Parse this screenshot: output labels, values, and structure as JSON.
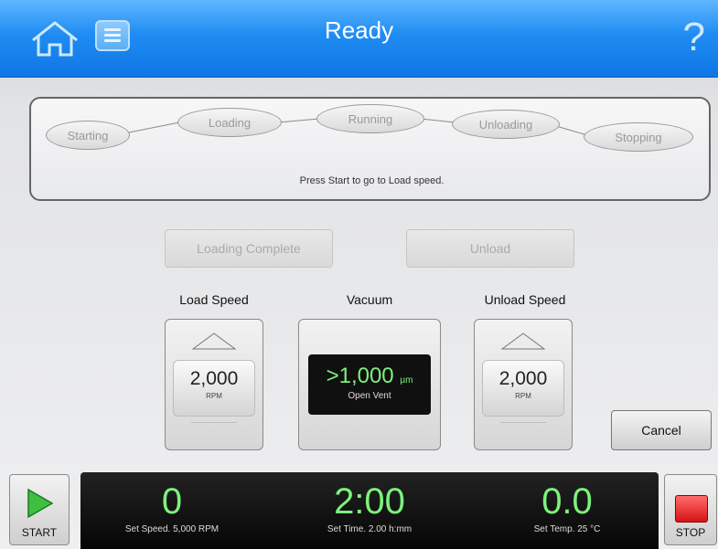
{
  "header": {
    "title": "Ready",
    "help_symbol": "?",
    "icons": [
      "home-icon",
      "list-icon",
      "help-icon"
    ]
  },
  "steps": {
    "items": [
      "Starting",
      "Loading",
      "Running",
      "Unloading",
      "Stopping"
    ],
    "message": "Press Start to go to Load speed."
  },
  "actions": {
    "loading_complete": "Loading Complete",
    "unload": "Unload"
  },
  "controls": {
    "load_speed": {
      "label": "Load Speed",
      "value": "2,000",
      "unit": "RPM"
    },
    "vacuum": {
      "label": "Vacuum",
      "value": ">1,000",
      "unit": "µm",
      "status": "Open Vent"
    },
    "unload_speed": {
      "label": "Unload Speed",
      "value": "2,000",
      "unit": "RPM"
    }
  },
  "cancel_label": "Cancel",
  "bottom": {
    "start_label": "START",
    "stop_label": "STOP",
    "speed": {
      "value": "0",
      "sub": "Set Speed. 5,000 RPM"
    },
    "time": {
      "value": "2:00",
      "sub": "Set Time. 2.00 h:mm"
    },
    "temp": {
      "value": "0.0",
      "sub": "Set Temp. 25 °C"
    }
  },
  "colors": {
    "header_blue": "#1f8cf2",
    "display_green": "#7cf27c",
    "stop_red": "#d71414",
    "start_green": "#3fbf3f"
  }
}
